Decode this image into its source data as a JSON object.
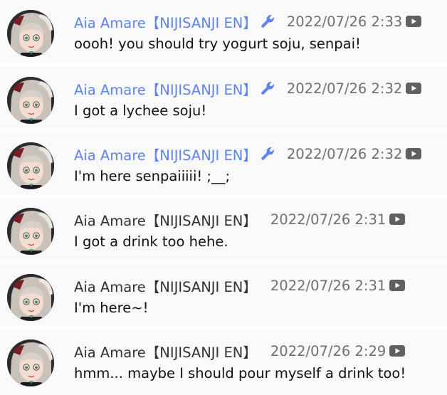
{
  "colors": {
    "moderator_name": "#5f84f1",
    "member_name": "#333333",
    "timestamp": "#707070",
    "message_text": "#111111",
    "row_background": "#f9f9f9"
  },
  "messages": [
    {
      "author": "Aia Amare【NIJISANJI EN】",
      "badge": "wrench-icon",
      "timestamp": "2022/07/26 2:33",
      "platform_icon": "youtube-icon",
      "text": "oooh! you should try yogurt soju, senpai!"
    },
    {
      "author": "Aia Amare【NIJISANJI EN】",
      "badge": "wrench-icon",
      "timestamp": "2022/07/26 2:32",
      "platform_icon": "youtube-icon",
      "text": "I got a lychee soju!"
    },
    {
      "author": "Aia Amare【NIJISANJI EN】",
      "badge": "wrench-icon",
      "timestamp": "2022/07/26 2:32",
      "platform_icon": "youtube-icon",
      "text": "I'm here senpaiiiii! ;__;"
    },
    {
      "author": "Aia Amare【NIJISANJI EN】",
      "badge": "",
      "timestamp": "2022/07/26 2:31",
      "platform_icon": "youtube-icon",
      "text": "I got a drink too hehe."
    },
    {
      "author": "Aia Amare【NIJISANJI EN】",
      "badge": "",
      "timestamp": "2022/07/26 2:31",
      "platform_icon": "youtube-icon",
      "text": "I'm here~!"
    },
    {
      "author": "Aia Amare【NIJISANJI EN】",
      "badge": "",
      "timestamp": "2022/07/26 2:29",
      "platform_icon": "youtube-icon",
      "text": "hmm... maybe I should pour myself a drink too!"
    }
  ]
}
